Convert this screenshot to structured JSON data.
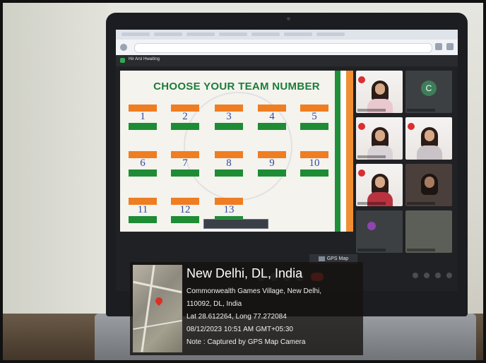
{
  "meeting": {
    "title": "Hir Arsl Hwaiting"
  },
  "slide": {
    "title": "CHOOSE YOUR TEAM NUMBER",
    "teams": [
      "1",
      "2",
      "3",
      "4",
      "5",
      "6",
      "7",
      "8",
      "9",
      "10",
      "11",
      "12",
      "13"
    ]
  },
  "camera_button": "GPS Map Camera",
  "participant_avatar_letter": "C",
  "gps": {
    "place": "New Delhi, DL, India",
    "address_line1": "Commonwealth Games Village, New Delhi,",
    "address_line2": "110092, DL, India",
    "coords": "Lat 28.612264, Long 77.272084",
    "datetime": "08/12/2023 10:51 AM GMT+05:30",
    "note": "Note : Captured by GPS Map Camera"
  },
  "colors": {
    "orange": "#ef7d22",
    "green": "#1e8c34",
    "title_green": "#1b7d3a",
    "number_blue": "#2f4aa6"
  }
}
